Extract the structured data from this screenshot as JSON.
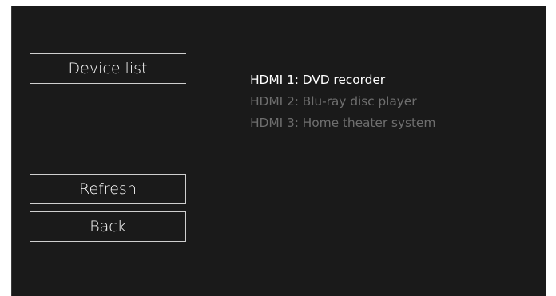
{
  "screen": {
    "section_title": "Device list"
  },
  "devices": [
    {
      "label": "HDMI 1: DVD recorder",
      "selected": true
    },
    {
      "label": "HDMI 2: Blu-ray disc player",
      "selected": false
    },
    {
      "label": "HDMI 3: Home theater system",
      "selected": false
    }
  ],
  "buttons": {
    "refresh_label": "Refresh",
    "back_label": "Back"
  },
  "colors": {
    "background": "#1a1a1a",
    "selected_text": "#ffffff",
    "unselected_text": "#6e6e6e",
    "border": "#cfcfcf"
  }
}
